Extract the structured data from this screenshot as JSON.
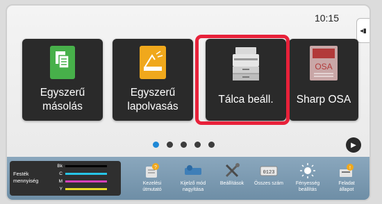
{
  "clock": "10:15",
  "side_tab": {
    "icon": "collapse-left-icon",
    "glyph": "◂▮"
  },
  "tiles": [
    {
      "label_line1": "Egyszerű",
      "label_line2": "másolás",
      "icon": "copy-icon"
    },
    {
      "label_line1": "Egyszerű",
      "label_line2": "lapolvasás",
      "icon": "scanner-icon"
    },
    {
      "label_line1": "Tálca beáll.",
      "label_line2": "",
      "icon": "printer-icon"
    },
    {
      "label_line1": "Sharp OSA",
      "label_line2": "",
      "icon": "osa-icon"
    }
  ],
  "pager": {
    "page_count": 5,
    "active_index": 0,
    "next_glyph": "▶"
  },
  "toner": {
    "label_line1": "Festék",
    "label_line2": "mennyiség",
    "channels": [
      {
        "name": "Bk",
        "color": "#000000"
      },
      {
        "name": "C",
        "color": "#27c4e6"
      },
      {
        "name": "M",
        "color": "#d43fb8"
      },
      {
        "name": "Y",
        "color": "#e8d928"
      }
    ]
  },
  "bottom_bar": [
    {
      "line1": "Kezelési",
      "line2": "útmutató",
      "icon": "manual-icon"
    },
    {
      "line1": "Kijelző mód",
      "line2": "nagyítása",
      "icon": "display-zoom-icon"
    },
    {
      "line1": "Beállítások",
      "line2": "",
      "icon": "settings-tools-icon"
    },
    {
      "line1": "Összes szám",
      "line2": "",
      "icon": "counter-icon"
    },
    {
      "line1": "Fényesség",
      "line2": "beállítás",
      "icon": "brightness-icon"
    },
    {
      "line1": "Feladat",
      "line2": "állapot",
      "icon": "job-status-icon"
    }
  ],
  "colors": {
    "highlight": "#e8213a",
    "active_dot": "#1e88d6",
    "tile_bg": "#2a2a2a"
  }
}
